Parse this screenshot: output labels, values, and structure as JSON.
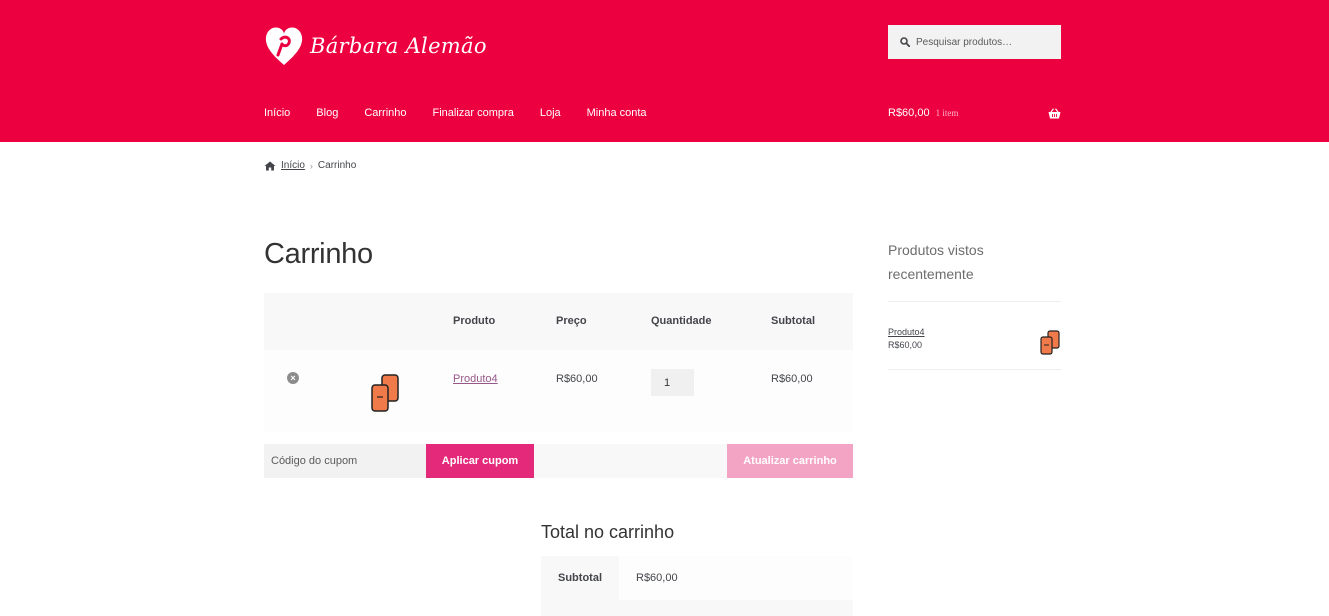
{
  "header": {
    "logo_text": "Bárbara Alemão",
    "search_placeholder": "Pesquisar produtos…",
    "nav": [
      "Início",
      "Blog",
      "Carrinho",
      "Finalizar compra",
      "Loja",
      "Minha conta"
    ],
    "minicart_amount": "R$60,00",
    "minicart_count": "1 item"
  },
  "colors": {
    "brand": "#ec0040",
    "button": "#e5297a",
    "button_disabled": "#f3a3c3",
    "link": "#96588a"
  },
  "breadcrumb": {
    "home": "Início",
    "current": "Carrinho"
  },
  "page_title": "Carrinho",
  "cart": {
    "headers": {
      "product": "Produto",
      "price": "Preço",
      "quantity": "Quantidade",
      "subtotal": "Subtotal"
    },
    "rows": [
      {
        "product": "Produto4",
        "price": "R$60,00",
        "quantity": "1",
        "subtotal": "R$60,00"
      }
    ],
    "coupon_placeholder": "Código do cupom",
    "apply_coupon": "Aplicar cupom",
    "update_cart": "Atualizar carrinho"
  },
  "totals": {
    "title": "Total no carrinho",
    "subtotal_label": "Subtotal",
    "subtotal_value": "R$60,00"
  },
  "sidebar": {
    "widget_title": "Produtos vistos recentemente",
    "items": [
      {
        "name": "Produto4",
        "price": "R$60,00"
      }
    ]
  }
}
